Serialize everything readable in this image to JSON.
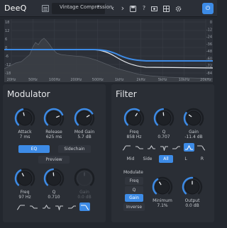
{
  "header": {
    "app_title": "DeeQ",
    "preset_name": "Vintage Compression",
    "toolbar_icons": [
      "list-icon",
      "chevron-down-icon",
      "chevron-left-icon",
      "chevron-right-icon",
      "save-icon",
      "help-icon",
      "screenshot-icon",
      "grid-icon",
      "settings-icon",
      "power-icon"
    ],
    "help_glyph": "?",
    "left_glyph": "‹",
    "right_glyph": "›",
    "caret_glyph": "▾",
    "power_glyph": "⏻",
    "accent_color": "#3d8be6"
  },
  "graph": {
    "left_axis": [
      "18",
      "12",
      "6",
      "0",
      "-6",
      "-12",
      "-18"
    ],
    "right_axis": [
      "0",
      "-12",
      "-24",
      "-36",
      "-48",
      "-60",
      "-72",
      "-84"
    ],
    "x_axis": [
      "20Hz",
      "50Hz",
      "100Hz",
      "200Hz",
      "500Hz",
      "1kHz",
      "2kHz",
      "5kHz",
      "10kHz",
      "20kHz"
    ],
    "curve_color": "#3d8be6"
  },
  "modulator": {
    "title": "Modulator",
    "knobs": [
      {
        "label": "Attack",
        "value": "7 ms",
        "level": 0.45
      },
      {
        "label": "Release",
        "value": "625 ms",
        "level": 0.75
      },
      {
        "label": "Mod Gain",
        "value": "5.7 dB",
        "level": 0.72
      }
    ],
    "mode_tabs": [
      {
        "label": "EQ",
        "active": true
      },
      {
        "label": "Sidechain",
        "active": false
      }
    ],
    "preview_label": "Preview",
    "filter_knobs": [
      {
        "label": "Freq",
        "value": "97 Hz",
        "level": 0.4
      },
      {
        "label": "Q",
        "value": "0.710",
        "level": 0.48
      },
      {
        "label": "Gain",
        "value": "0.0 dB",
        "level": 0.5,
        "disabled": true
      }
    ],
    "shapes": [
      "low-cut-shape-icon",
      "low-shelf-shape-icon",
      "peak-shape-icon",
      "notch-shape-icon",
      "high-shelf-shape-icon",
      "high-cut-shape-icon"
    ],
    "active_shape": 5
  },
  "filter": {
    "title": "Filter",
    "knobs": [
      {
        "label": "Freq",
        "value": "858 Hz",
        "level": 0.62
      },
      {
        "label": "Q",
        "value": "0.707",
        "level": 0.48
      },
      {
        "label": "Gain",
        "value": "-11.4 dB",
        "level": 0.3
      }
    ],
    "shapes": [
      "low-cut-shape-icon",
      "low-shelf-shape-icon",
      "peak-shape-icon",
      "notch-shape-icon",
      "high-shelf-shape-icon",
      "band-shape-icon",
      "high-cut-shape-icon"
    ],
    "active_shape": 5,
    "channels": [
      {
        "label": "Mid",
        "active": false
      },
      {
        "label": "Side",
        "active": false
      },
      {
        "label": "All",
        "active": true
      },
      {
        "label": "L",
        "active": false
      },
      {
        "label": "R",
        "active": false
      }
    ],
    "modulate_label": "Modulate",
    "modulate_targets": [
      {
        "label": "Freq",
        "active": false
      },
      {
        "label": "Q",
        "active": false
      },
      {
        "label": "Gain",
        "active": true
      }
    ],
    "inverse_label": "Inverse",
    "extra_knobs": [
      {
        "label": "Minimum",
        "value": "7.1%",
        "level": 0.38
      },
      {
        "label": "Output",
        "value": "0.0 dB",
        "level": 0.5
      }
    ]
  }
}
